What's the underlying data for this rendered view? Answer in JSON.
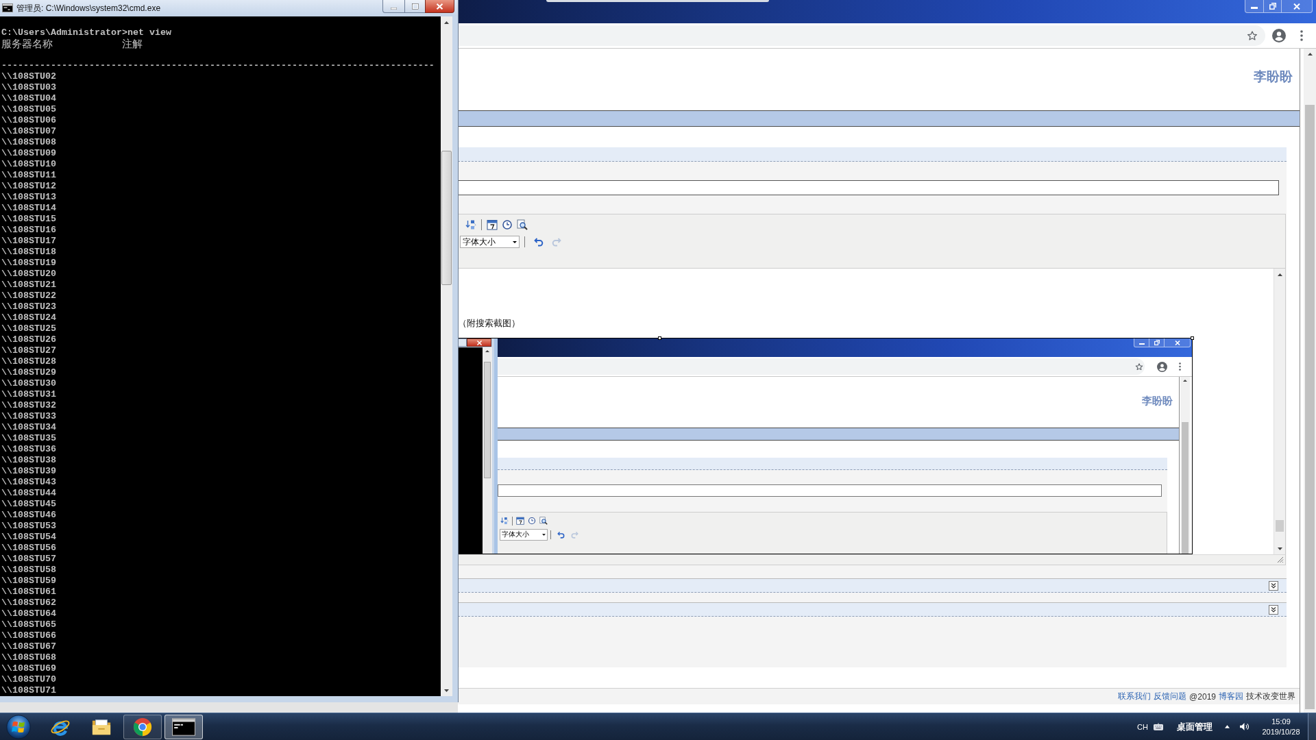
{
  "cmd_window": {
    "title": "管理员: C:\\Windows\\system32\\cmd.exe",
    "command": "C:\\Users\\Administrator>net view",
    "columns": [
      "服务器名称",
      "注解"
    ],
    "separator": "-------------------------------------------------------------------------------",
    "servers": [
      "\\\\108STU02",
      "\\\\108STU03",
      "\\\\108STU04",
      "\\\\108STU05",
      "\\\\108STU06",
      "\\\\108STU07",
      "\\\\108STU08",
      "\\\\108STU09",
      "\\\\108STU10",
      "\\\\108STU11",
      "\\\\108STU12",
      "\\\\108STU13",
      "\\\\108STU14",
      "\\\\108STU15",
      "\\\\108STU16",
      "\\\\108STU17",
      "\\\\108STU18",
      "\\\\108STU19",
      "\\\\108STU20",
      "\\\\108STU21",
      "\\\\108STU22",
      "\\\\108STU23",
      "\\\\108STU24",
      "\\\\108STU25",
      "\\\\108STU26",
      "\\\\108STU27",
      "\\\\108STU28",
      "\\\\108STU29",
      "\\\\108STU30",
      "\\\\108STU31",
      "\\\\108STU32",
      "\\\\108STU33",
      "\\\\108STU34",
      "\\\\108STU35",
      "\\\\108STU36",
      "\\\\108STU38",
      "\\\\108STU39",
      "\\\\108STU43",
      "\\\\108STU44",
      "\\\\108STU45",
      "\\\\108STU46",
      "\\\\108STU53",
      "\\\\108STU54",
      "\\\\108STU56",
      "\\\\108STU57",
      "\\\\108STU58",
      "\\\\108STU59",
      "\\\\108STU61",
      "\\\\108STU62",
      "\\\\108STU64",
      "\\\\108STU65",
      "\\\\108STU66",
      "\\\\108STU67",
      "\\\\108STU68",
      "\\\\108STU69",
      "\\\\108STU70",
      "\\\\108STU71"
    ]
  },
  "browser": {
    "user_name": "李盼盼",
    "editor": {
      "font_size_select": "字体大小",
      "history_buttons": [
        {
          "kind": "undo",
          "disabled": false
        },
        {
          "kind": "redo",
          "disabled": true
        }
      ],
      "body_text": "（附搜索截图）",
      "image": {
        "selected": true,
        "user_name": "李盼盼",
        "font_size_select": "字体大小",
        "history_buttons": [
          {
            "kind": "undo",
            "disabled": false
          },
          {
            "kind": "redo",
            "disabled": true
          }
        ]
      }
    },
    "sections": [
      {
        "expanded": false
      },
      {
        "expanded": false
      }
    ],
    "footer": [
      {
        "kind": "link",
        "text": "联系我们"
      },
      {
        "kind": "link",
        "text": "反馈问题"
      },
      {
        "kind": "text",
        "text": "@2019"
      },
      {
        "kind": "link",
        "text": "博客园"
      },
      {
        "kind": "text",
        "text": "技术改变世界"
      }
    ]
  },
  "taskbar": {
    "apps": [
      {
        "kind": "ie",
        "running": false,
        "selected": false
      },
      {
        "kind": "explorer",
        "running": false,
        "selected": false
      },
      {
        "kind": "chrome",
        "running": true,
        "selected": false
      },
      {
        "kind": "cmd",
        "running": true,
        "selected": true
      }
    ],
    "input_language": "CH",
    "toolbar_label": "桌面管理",
    "time": "15:09",
    "date": "2019/10/28"
  }
}
